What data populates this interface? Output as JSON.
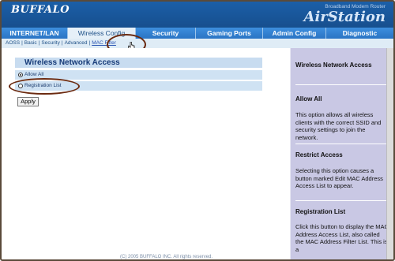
{
  "header": {
    "logo": "BUFFALO",
    "product_sub": "Broadband Modem Router",
    "product": "AirStation"
  },
  "tabs": [
    {
      "label": "INTERNET/LAN"
    },
    {
      "label": "Wireless Config"
    },
    {
      "label": "Security"
    },
    {
      "label": "Gaming Ports"
    },
    {
      "label": "Admin Config"
    },
    {
      "label": "Diagnostic"
    }
  ],
  "subnav": {
    "items": [
      "AOSS",
      "Basic",
      "Security",
      "Advanced",
      "MAC Filter"
    ]
  },
  "main": {
    "section_title": "Wireless Network Access",
    "options": [
      {
        "label": "Allow All",
        "selected": true
      },
      {
        "label": "Registration List",
        "selected": false
      }
    ],
    "apply_label": "Apply"
  },
  "help": {
    "title": "Wireless Network Access",
    "sections": [
      {
        "heading": "Allow All",
        "text": "This option allows all wireless clients with the correct SSID and security settings to join the network."
      },
      {
        "heading": "Restrict Access",
        "text": "Selecting this option causes a button marked Edit MAC Address Access List to appear."
      },
      {
        "heading": "Registration List",
        "text": "Click this button to display the MAC Address Access List, also called the MAC Address Filter List. This is a"
      }
    ]
  },
  "footer": "(C) 2005 BUFFALO INC. All rights reserved.",
  "colors": {
    "accent": "#1b5fa8",
    "tab": "#2f7fcf",
    "help_bg": "#c9c8e4",
    "annotation": "#6b2a10"
  }
}
